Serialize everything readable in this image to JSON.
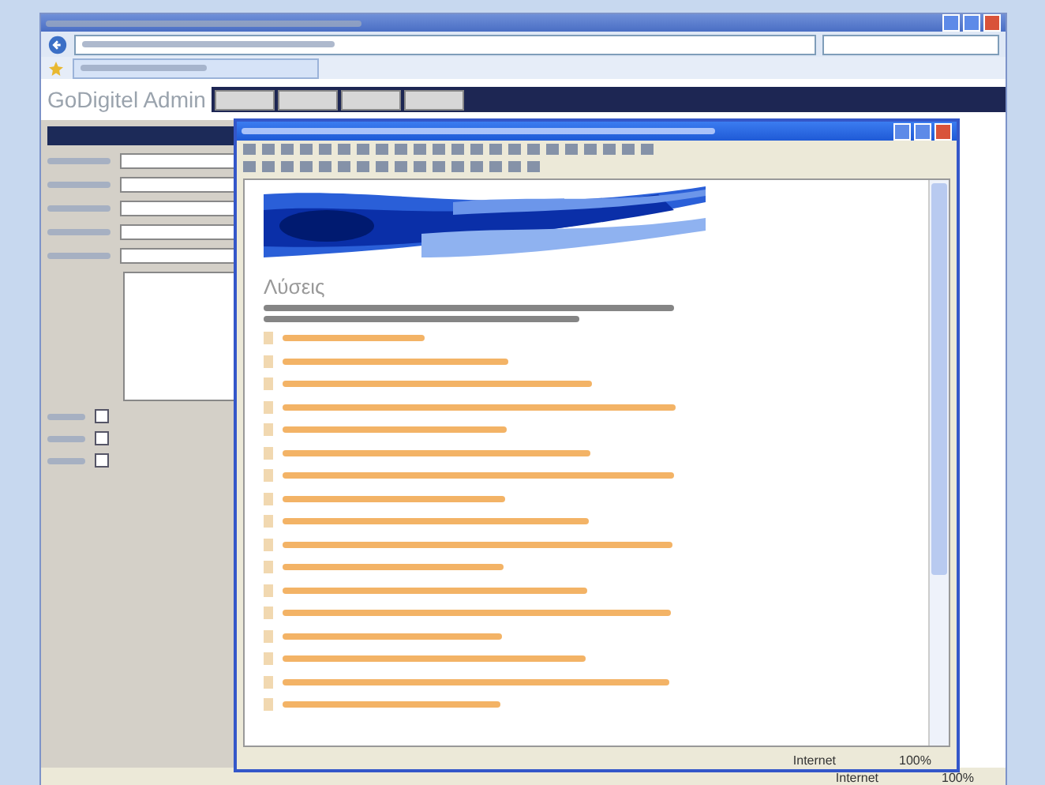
{
  "browser": {
    "logo": "GoDigitel Admin"
  },
  "left_panel": {
    "checkboxes": [
      {
        "checked": false
      },
      {
        "checked": false
      },
      {
        "checked": false
      }
    ]
  },
  "popup": {
    "heading": "Λύσεις",
    "items": [
      {
        "kind": "link"
      },
      {
        "kind": "link"
      },
      {
        "kind": "link"
      },
      {
        "kind": "link"
      },
      {
        "kind": "link"
      },
      {
        "kind": "link"
      },
      {
        "kind": "link"
      },
      {
        "kind": "link"
      },
      {
        "kind": "link"
      },
      {
        "kind": "link"
      },
      {
        "kind": "link"
      },
      {
        "kind": "link"
      },
      {
        "kind": "link"
      },
      {
        "kind": "link"
      },
      {
        "kind": "link"
      },
      {
        "kind": "link"
      },
      {
        "kind": "link"
      }
    ],
    "status_bar": {
      "zone": "Internet",
      "zoom": "100%"
    }
  },
  "status_bar": {
    "zone": "Internet",
    "zoom": "100%"
  }
}
